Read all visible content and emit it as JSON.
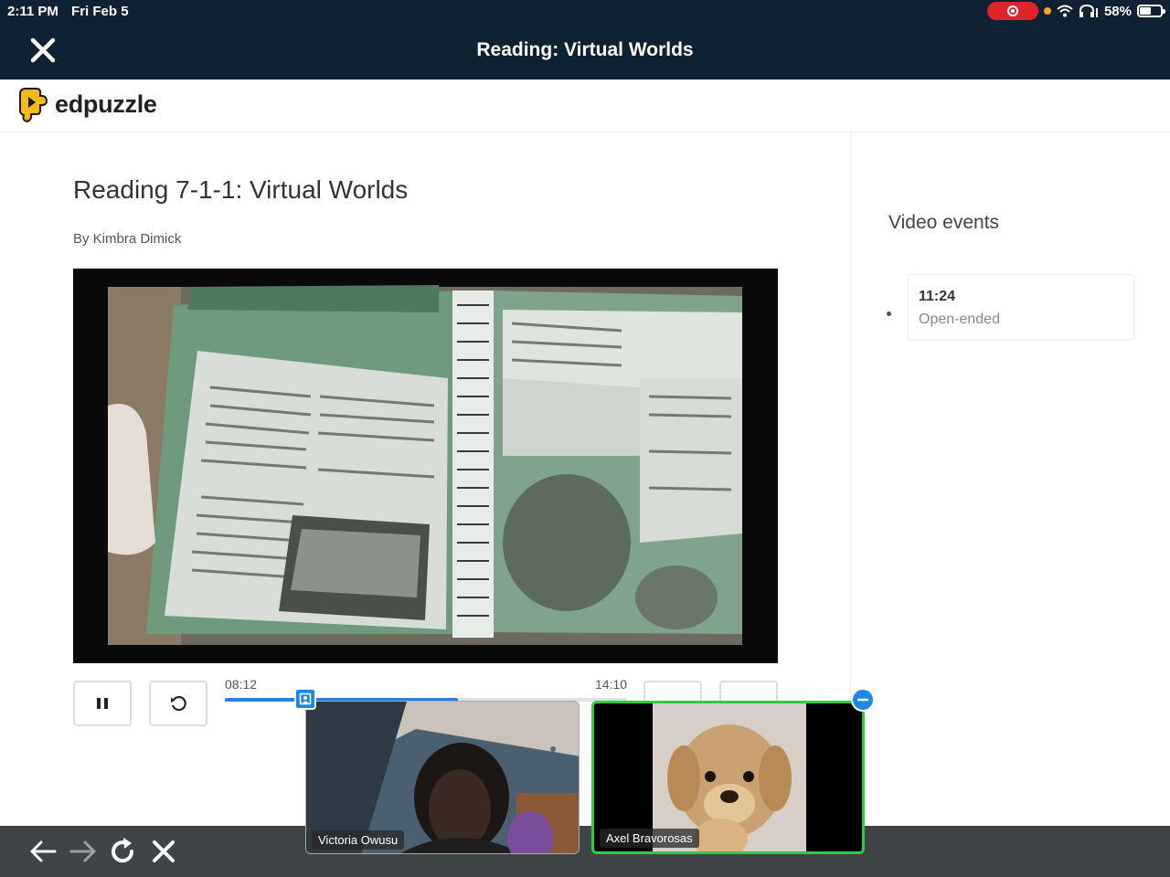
{
  "status_bar": {
    "time": "2:11 PM",
    "date": "Fri Feb 5",
    "battery": "58%"
  },
  "nav": {
    "title": "Reading: Virtual Worlds",
    "close_icon": "close-icon"
  },
  "brand": {
    "name": "edpuzzle",
    "accent": "#f5b91c"
  },
  "lesson": {
    "title": "Reading 7-1-1: Virtual Worlds",
    "author": "By Kimbra Dimick"
  },
  "player": {
    "current_time": "08:12",
    "total_time": "14:10",
    "progress": 0.58,
    "pause_icon": "pause-icon",
    "replay_icon": "replay-icon"
  },
  "video_events": {
    "title": "Video events",
    "events": [
      {
        "time": "11:24",
        "type": "Open-ended"
      }
    ]
  },
  "call": {
    "participants": [
      {
        "name": "Victoria Owusu"
      },
      {
        "name": "Axel Bravorosas"
      }
    ],
    "active_color": "#2ecc40"
  },
  "browser_toolbar": {
    "icons": [
      "back-arrow-icon",
      "forward-arrow-icon",
      "reload-icon",
      "close-icon"
    ]
  }
}
